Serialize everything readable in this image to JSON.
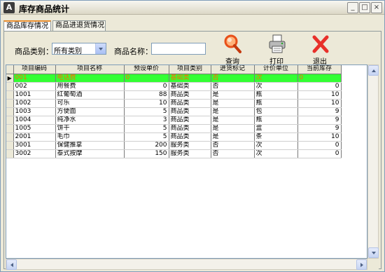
{
  "window": {
    "title": "库存商品统计",
    "controls": [
      "_",
      "□",
      "×"
    ]
  },
  "tabs": [
    {
      "label": "商品库存情况",
      "active": true
    },
    {
      "label": "商品进退货情况",
      "active": false
    }
  ],
  "filters": {
    "category_label": "商品类别：",
    "category_value": "所有类别",
    "name_label": "商品名称：",
    "name_value": ""
  },
  "toolbar": {
    "query_label": "查询",
    "print_label": "打印",
    "exit_label": "退出"
  },
  "table": {
    "columns": [
      "项目编码",
      "项目名称",
      "预设单价",
      "项目类别",
      "进货标记",
      "计价单位",
      "当前库存"
    ],
    "selected_row_indicator": "▶",
    "rows": [
      {
        "code": "001",
        "name": "电话费",
        "price": "0",
        "category": "基础类",
        "flag": "否",
        "unit": "次",
        "stock": "0"
      },
      {
        "code": "002",
        "name": "用餐费",
        "price": "0",
        "category": "基础类",
        "flag": "否",
        "unit": "次",
        "stock": "0"
      },
      {
        "code": "1001",
        "name": "红葡萄酒",
        "price": "88",
        "category": "商品类",
        "flag": "是",
        "unit": "瓶",
        "stock": "10"
      },
      {
        "code": "1002",
        "name": "可乐",
        "price": "10",
        "category": "商品类",
        "flag": "是",
        "unit": "瓶",
        "stock": "10"
      },
      {
        "code": "1003",
        "name": "方便面",
        "price": "5",
        "category": "商品类",
        "flag": "是",
        "unit": "包",
        "stock": "9"
      },
      {
        "code": "1004",
        "name": "纯净水",
        "price": "3",
        "category": "商品类",
        "flag": "是",
        "unit": "瓶",
        "stock": "9"
      },
      {
        "code": "1005",
        "name": "饼干",
        "price": "5",
        "category": "商品类",
        "flag": "是",
        "unit": "盒",
        "stock": "9"
      },
      {
        "code": "2001",
        "name": "毛巾",
        "price": "5",
        "category": "商品类",
        "flag": "是",
        "unit": "条",
        "stock": "10"
      },
      {
        "code": "3001",
        "name": "保健推拿",
        "price": "200",
        "category": "服务类",
        "flag": "否",
        "unit": "次",
        "stock": "0"
      },
      {
        "code": "3002",
        "name": "泰式按摩",
        "price": "150",
        "category": "服务类",
        "flag": "否",
        "unit": "次",
        "stock": "0"
      }
    ]
  },
  "colors": {
    "selected_row_bg": "#33ff33",
    "selected_row_text": "#ff6a00",
    "exit_icon": "#e8302a",
    "query_icon": "#e8501a"
  },
  "icons": {
    "app": "app-icon",
    "query": "magnifier-icon",
    "print": "printer-icon",
    "exit": "red-x-icon"
  }
}
